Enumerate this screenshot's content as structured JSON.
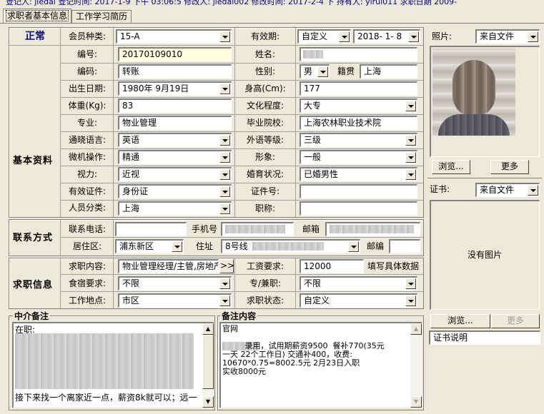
{
  "status_bar": {
    "text": "登记人: jiedai    登记时间: 2017-1-9 下午 03:06:5 修改人: jiedai002    修改时间: 2017-2-4 下 持有人: yirui011              求职日期 2009-"
  },
  "tabs": [
    {
      "label": "求职者基本信息"
    },
    {
      "label": "工作学习简历"
    }
  ],
  "status_label": "正常",
  "sections": {
    "basic": "基本资料",
    "contact": "联系方式",
    "job": "求职信息",
    "agent_note": "中介备注",
    "remark": "备注内容"
  },
  "fields": {
    "member_type": {
      "label": "会员种类:",
      "value": "15-A"
    },
    "validity": {
      "label": "有效期:",
      "value": "自定义",
      "date": "2018- 1- 8"
    },
    "number": {
      "label": "编号:",
      "value": "20170109010"
    },
    "name": {
      "label": "姓名:",
      "value": ""
    },
    "code": {
      "label": "编码:",
      "value": "转账"
    },
    "gender": {
      "label": "性别:",
      "value": "男"
    },
    "native": {
      "label": "籍贯",
      "value": "上海"
    },
    "birth": {
      "label": "出生日期:",
      "value": "1980年 9月19日"
    },
    "height": {
      "label": "身高(Cm):",
      "value": "177"
    },
    "weight": {
      "label": "体重(Kg):",
      "value": "83"
    },
    "education": {
      "label": "文化程度:",
      "value": "大专"
    },
    "major": {
      "label": "专业:",
      "value": "物业管理"
    },
    "school": {
      "label": "毕业院校:",
      "value": "上海农林职业技术院"
    },
    "language": {
      "label": "通晓语言:",
      "value": "英语"
    },
    "lang_level": {
      "label": "外语等级:",
      "value": "三级"
    },
    "computer": {
      "label": "微机操作:",
      "value": "精通"
    },
    "appearance": {
      "label": "形象:",
      "value": "一般"
    },
    "vision": {
      "label": "视力:",
      "value": "近视"
    },
    "marital": {
      "label": "婚育状况:",
      "value": "已婚男性"
    },
    "id_type": {
      "label": "有效证件:",
      "value": "身份证"
    },
    "id_no": {
      "label": "证件号:",
      "value": ""
    },
    "category": {
      "label": "人员分类:",
      "value": "上海"
    },
    "title": {
      "label": "职称:",
      "value": ""
    },
    "phone": {
      "label": "联系电话:",
      "value": ""
    },
    "mobile": {
      "label": "手机号",
      "value": ""
    },
    "email": {
      "label": "邮箱",
      "value": ""
    },
    "district": {
      "label": "居住区:",
      "value": "浦东新区"
    },
    "address": {
      "label": "住址",
      "value": "8号线"
    },
    "zip": {
      "label": "邮编",
      "value": ""
    },
    "job_content": {
      "label": "求职内容:",
      "value": "物业管理经理/主管,房地产",
      "more": ">>"
    },
    "salary": {
      "label": "工资要求:",
      "value": "12000",
      "hint": "填写具体数据"
    },
    "board": {
      "label": "食宿要求:",
      "value": "不限"
    },
    "fulltime": {
      "label": "专/兼职:",
      "value": "不限"
    },
    "workplace": {
      "label": "工作地点:",
      "value": "市区"
    },
    "job_status": {
      "label": "求职状态:",
      "value": "自定义"
    }
  },
  "notes": {
    "agent_first": "在职:",
    "agent_last": "接下来找一个离家近一点，薪资8k就可以；远一",
    "remark_lines": [
      "官网",
      "         录用，试用期薪资9500  餐补770(35元",
      "一天 22个工作日) 交通补400，收费:",
      "10670*0.75=8002.5元 2月23日入职",
      "实收8000元"
    ]
  },
  "photo": {
    "label": "照片:",
    "source": "来自文件",
    "browse": "浏览...",
    "more": "更多"
  },
  "cert": {
    "label": "证书:",
    "source": "来自文件",
    "empty": "没有图片",
    "browse": "浏览...",
    "more": "更多",
    "desc": "证书说明"
  }
}
